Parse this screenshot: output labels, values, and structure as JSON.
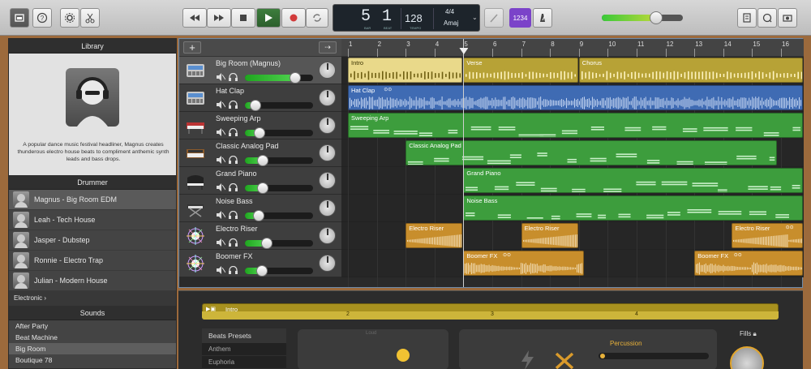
{
  "toolbar": {
    "lcd": {
      "bar": "5",
      "beat": "1",
      "bar_label": "BAR",
      "beat_label": "BEAT",
      "tempo": "128",
      "tempo_label": "TEMPO",
      "time_sig": "4/4",
      "key": "Amaj"
    },
    "count_in": "1234",
    "master_volume": 0.65
  },
  "library": {
    "title": "Library",
    "description": "A popular dance music festival headliner, Magnus creates thunderous electro house beats to compliment anthemic synth leads and bass drops.",
    "drummer_heading": "Drummer",
    "drummers": [
      {
        "name": "Magnus - Big Room EDM",
        "selected": true
      },
      {
        "name": "Leah - Tech House",
        "selected": false
      },
      {
        "name": "Jasper - Dubstep",
        "selected": false
      },
      {
        "name": "Ronnie - Electro Trap",
        "selected": false
      },
      {
        "name": "Julian - Modern House",
        "selected": false
      }
    ],
    "genre": "Electronic",
    "sounds_heading": "Sounds",
    "sounds": [
      {
        "name": "After Party",
        "selected": false
      },
      {
        "name": "Beat Machine",
        "selected": false
      },
      {
        "name": "Big Room",
        "selected": true
      },
      {
        "name": "Boutique 78",
        "selected": false
      }
    ]
  },
  "tracks": [
    {
      "name": "Big Room (Magnus)",
      "volume": 0.74,
      "icon": "drum-machine-icon",
      "selected": true
    },
    {
      "name": "Hat Clap",
      "volume": 0.15,
      "icon": "drum-machine-icon",
      "selected": false
    },
    {
      "name": "Sweeping Arp",
      "volume": 0.21,
      "icon": "synth-icon",
      "selected": false
    },
    {
      "name": "Classic Analog Pad",
      "volume": 0.26,
      "icon": "keyboard-icon",
      "selected": false
    },
    {
      "name": "Grand Piano",
      "volume": 0.26,
      "icon": "piano-icon",
      "selected": false
    },
    {
      "name": "Noise Bass",
      "volume": 0.2,
      "icon": "keyboard-stand-icon",
      "selected": false
    },
    {
      "name": "Electro Riser",
      "volume": 0.32,
      "icon": "sparkle-icon",
      "selected": false
    },
    {
      "name": "Boomer FX",
      "volume": 0.25,
      "icon": "sparkle-icon",
      "selected": false
    }
  ],
  "ruler": {
    "bars": [
      "1",
      "2",
      "3",
      "4",
      "5",
      "6",
      "7",
      "8",
      "9",
      "10",
      "11",
      "12",
      "13",
      "14",
      "15",
      "16"
    ]
  },
  "regions": [
    {
      "track": 0,
      "label": "Intro",
      "start": 1,
      "end": 5,
      "color": "#e9d98a",
      "type": "drum"
    },
    {
      "track": 0,
      "label": "Verse",
      "start": 5,
      "end": 9,
      "color": "#b7a236",
      "type": "drum"
    },
    {
      "track": 0,
      "label": "Chorus",
      "start": 9,
      "end": 17,
      "color": "#b7a236",
      "type": "drum"
    },
    {
      "track": 1,
      "label": "Hat Clap",
      "start": 1,
      "end": 17,
      "color": "#3f6bb3",
      "type": "audio",
      "loop": true
    },
    {
      "track": 2,
      "label": "Sweeping Arp",
      "start": 1,
      "end": 17,
      "color": "#3d9d3d",
      "type": "midi"
    },
    {
      "track": 3,
      "label": "Classic Analog Pad",
      "start": 3,
      "end": 15.9,
      "color": "#3d9d3d",
      "type": "midi"
    },
    {
      "track": 4,
      "label": "Grand Piano",
      "start": 5,
      "end": 17,
      "color": "#3d9d3d",
      "type": "midi"
    },
    {
      "track": 5,
      "label": "Noise Bass",
      "start": 5,
      "end": 17,
      "color": "#3d9d3d",
      "type": "midi"
    },
    {
      "track": 6,
      "label": "Electro Riser",
      "start": 3,
      "end": 5,
      "color": "#c88e2c",
      "type": "audio"
    },
    {
      "track": 6,
      "label": "Electro Riser",
      "start": 7,
      "end": 9,
      "color": "#c88e2c",
      "type": "audio"
    },
    {
      "track": 6,
      "label": "Electro Riser",
      "start": 14.3,
      "end": 17,
      "color": "#c88e2c",
      "type": "audio",
      "loop": true
    },
    {
      "track": 7,
      "label": "Boomer FX",
      "start": 5,
      "end": 9.2,
      "color": "#c88e2c",
      "type": "audio",
      "loop": true
    },
    {
      "track": 7,
      "label": "Boomer FX",
      "start": 13,
      "end": 17,
      "color": "#c88e2c",
      "type": "audio",
      "loop": true
    }
  ],
  "playhead_bar": 5,
  "editor": {
    "region_label": "Intro",
    "bar_numbers": [
      "2",
      "3",
      "4"
    ],
    "beats_heading": "Beats Presets",
    "beats": [
      "Anthem",
      "Euphoria"
    ],
    "xy_label": "Loud",
    "percussion_label": "Percussion",
    "fills_label": "Fills"
  }
}
